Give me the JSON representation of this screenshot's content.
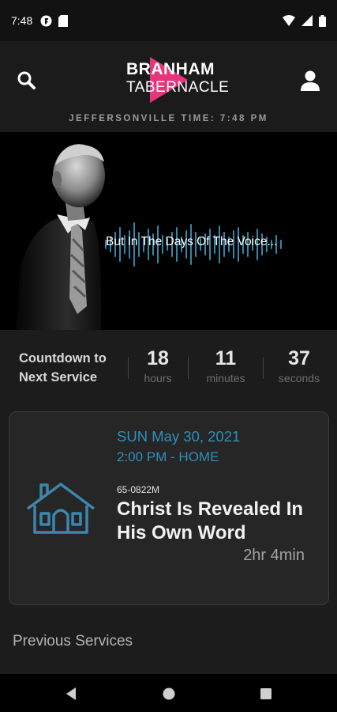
{
  "status_bar": {
    "time": "7:48",
    "icons": [
      "notification-f-icon",
      "sd-card-icon",
      "wifi-icon",
      "signal-icon",
      "battery-icon"
    ]
  },
  "header": {
    "logo_line1": "BRANHAM",
    "logo_line2": "TABERNACLE",
    "jeffersonville_time": "JEFFERSONVILLE TIME:  7:48 PM",
    "icons": [
      "search-icon",
      "user-icon"
    ]
  },
  "hero": {
    "caption": "But In The Days Of The Voice..."
  },
  "countdown": {
    "label_line1": "Countdown to",
    "label_line2": "Next Service",
    "hours_value": "18",
    "hours_label": "hours",
    "minutes_value": "11",
    "minutes_label": "minutes",
    "seconds_value": "37",
    "seconds_label": "seconds"
  },
  "service": {
    "date": "SUN May 30, 2021",
    "time_location": "2:00 PM - HOME",
    "code": "65-0822M",
    "title": "Christ Is Revealed In His Own Word",
    "duration": "2hr 4min"
  },
  "previous": {
    "heading": "Previous Services"
  },
  "colors": {
    "accent": "#2f8fb8",
    "logo_pink": "#e6357a",
    "background": "#1c1c1c",
    "card": "#262626"
  }
}
